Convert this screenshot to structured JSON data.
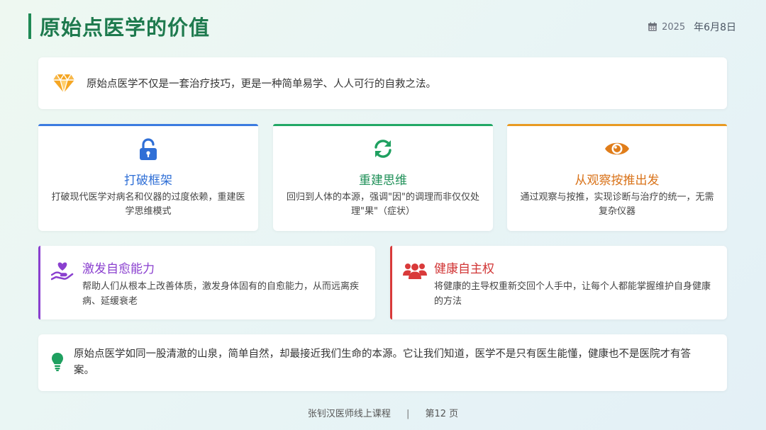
{
  "header": {
    "title": "原始点医学的价值",
    "date_year": "2025",
    "date_rest": "年6月8日"
  },
  "intro": {
    "icon": "diamond-icon",
    "text": "原始点医学不仅是一套治疗技巧，更是一种简单易学、人人可行的自救之法。"
  },
  "features": [
    {
      "icon": "unlock-icon",
      "title": "打破框架",
      "description": "打破现代医学对病名和仪器的过度依赖，重建医学思维模式",
      "color": "#2f6fd6"
    },
    {
      "icon": "refresh-icon",
      "title": "重建思维",
      "description": "回归到人体的本源，强调\"因\"的调理而非仅仅处理\"果\"（症状）",
      "color": "#1fa060"
    },
    {
      "icon": "eye-icon",
      "title": "从观察按推出发",
      "description": "通过观察与按推，实现诊断与治疗的统一，无需复杂仪器",
      "color": "#d9731a"
    }
  ],
  "wide_cards": [
    {
      "icon": "hand-heart-icon",
      "title": "激发自愈能力",
      "description": "帮助人们从根本上改善体质，激发身体固有的自愈能力，从而远离疾病、延缓衰老",
      "color": "#8a3fcf"
    },
    {
      "icon": "people-icon",
      "title": "健康自主权",
      "description": "将健康的主导权重新交回个人手中，让每个人都能掌握维护自身健康的方法",
      "color": "#d93a3a"
    }
  ],
  "closing": {
    "icon": "lightbulb-icon",
    "text": "原始点医学如同一股清澈的山泉，简单自然，却最接近我们生命的本源。它让我们知道，医学不是只有医生能懂，健康也不是医院才有答案。"
  },
  "footer": {
    "course": "张钊汉医师线上课程",
    "separator": "|",
    "page": "第12 页"
  }
}
